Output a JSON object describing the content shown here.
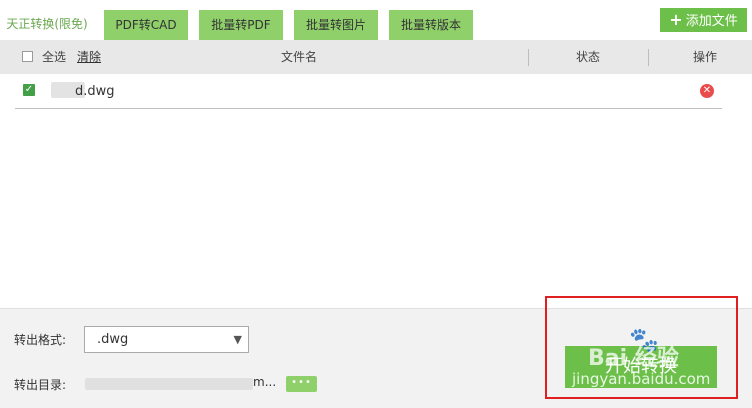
{
  "tabs": [
    {
      "label": "天正转换(限免)"
    },
    {
      "label": "PDF转CAD"
    },
    {
      "label": "批量转PDF"
    },
    {
      "label": "批量转图片"
    },
    {
      "label": "批量转版本"
    }
  ],
  "toolbar": {
    "add_file_label": "添加文件"
  },
  "table": {
    "select_all_label": "全选",
    "clear_label": "清除",
    "col_filename": "文件名",
    "col_status": "状态",
    "col_action": "操作",
    "rows": [
      {
        "filename_visible": "d.dwg",
        "checked": true,
        "status": ""
      }
    ]
  },
  "output": {
    "format_label": "转出格式:",
    "format_value": ".dwg",
    "dir_label": "转出目录:",
    "dir_value_visible": "m...",
    "browse_label": "•••"
  },
  "start_button_label": "开始转换",
  "watermark": {
    "main": "Bai 经验",
    "sub": "jingyan.baidu.com"
  },
  "colors": {
    "accent": "#6cc04a",
    "tab_bg": "#8fd06b",
    "highlight": "#e02020",
    "delete": "#e94c4c"
  }
}
